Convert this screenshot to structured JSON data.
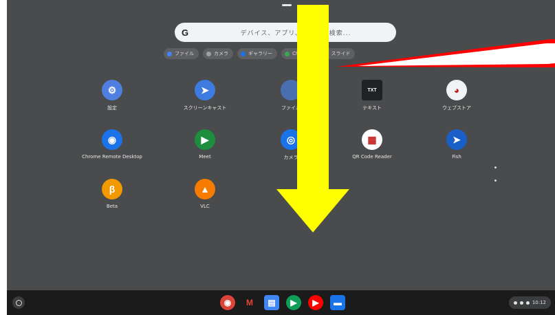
{
  "search": {
    "google_letter": "G",
    "placeholder": "デバイス、アプリ、ウェブを検索..."
  },
  "suggestions": [
    {
      "label": "ファイル",
      "color": "#4285f4"
    },
    {
      "label": "カメラ",
      "color": "#9aa0a6"
    },
    {
      "label": "ギャラリー",
      "color": "#1a73e8"
    },
    {
      "label": "Chrome",
      "color": "#34a853"
    },
    {
      "label": "スライド",
      "color": "#fbbc04"
    }
  ],
  "apps": [
    {
      "label": "設定",
      "glyph": "⚙",
      "icon": "settings-icon",
      "color": "#4f7fe0"
    },
    {
      "label": "スクリーンキャスト",
      "glyph": "➤",
      "icon": "screencast-icon",
      "color": "#3d7be0"
    },
    {
      "label": "ファイル",
      "glyph": "",
      "icon": "files-icon",
      "color": "#4a6fb0"
    },
    {
      "label": "テキスト",
      "glyph": "TXT",
      "icon": "text-icon",
      "color": "#202124"
    },
    {
      "label": "ウェブストア",
      "glyph": "◕",
      "icon": "web-store-icon",
      "color": "#f1f3f4"
    },
    {
      "label": "Chrome Remote Desktop",
      "glyph": "◉",
      "icon": "panda-icon",
      "color": "#1a73e8"
    },
    {
      "label": "Meet",
      "glyph": "▶",
      "icon": "meet-icon",
      "color": "#1e8e3e"
    },
    {
      "label": "カメラ",
      "glyph": "◎",
      "icon": "camera-icon",
      "color": "#1a73e8"
    },
    {
      "label": "QR Code Reader",
      "glyph": "▦",
      "icon": "qr-code-icon",
      "color": "#ffffff"
    },
    {
      "label": "Fish",
      "glyph": "➤",
      "icon": "fish-icon",
      "color": "#1a5fc8"
    },
    {
      "label": "Beta",
      "glyph": "β",
      "icon": "beta-icon",
      "color": "#f29900"
    },
    {
      "label": "VLC",
      "glyph": "▲",
      "icon": "vlc-icon",
      "color": "#f57c00"
    }
  ],
  "shelf": {
    "dock": [
      {
        "icon": "chrome-icon",
        "glyph": "◉",
        "color": "#db4437"
      },
      {
        "icon": "gmail-icon",
        "glyph": "M",
        "color": "#1b1b1c"
      },
      {
        "icon": "docs-icon",
        "glyph": "▤",
        "color": "#4285f4"
      },
      {
        "icon": "play-store-icon",
        "glyph": "▶",
        "color": "#0f9d58"
      },
      {
        "icon": "youtube-icon",
        "glyph": "▶",
        "color": "#ff0000"
      },
      {
        "icon": "messages-icon",
        "glyph": "▬",
        "color": "#1a73e8"
      }
    ],
    "tray_time": "10:12"
  },
  "annotations": {
    "arrow_color": "#ffff00",
    "pointer_color": "#ff0000"
  }
}
